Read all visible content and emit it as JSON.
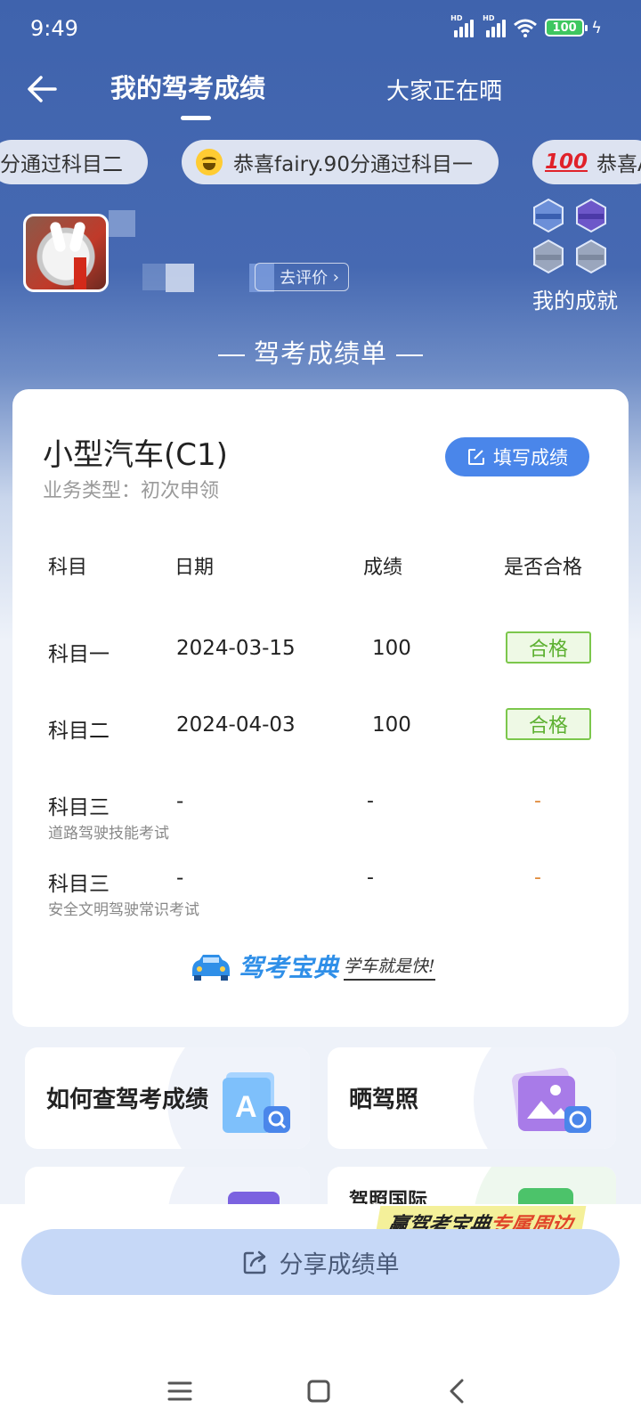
{
  "status_bar": {
    "time": "9:49",
    "signal1_label": "HD",
    "signal2_label": "HD",
    "battery": "100"
  },
  "header": {
    "tabs": [
      {
        "label": "我的驾考成绩",
        "active": true
      },
      {
        "label": "大家正在晒",
        "active": false
      }
    ]
  },
  "ticker": [
    {
      "text": "分通过科目二"
    },
    {
      "text": "恭喜fairy.90分通过科目一",
      "icon": "grinning-face-icon"
    },
    {
      "text": "恭喜A",
      "icon": "hundred-points-icon",
      "icon_text": "100"
    }
  ],
  "profile": {
    "rate_label": "去评价",
    "achievements_label": "我的成就"
  },
  "sheet_title": "驾考成绩单",
  "card": {
    "vehicle": "小型汽车(C1)",
    "business_type": "业务类型：初次申领",
    "fill_button": "填写成绩",
    "columns": [
      "科目",
      "日期",
      "成绩",
      "是否合格"
    ],
    "rows": [
      {
        "subject": "科目一",
        "subtitle": "",
        "date": "2024-03-15",
        "score": "100",
        "result": "合格",
        "passed": true
      },
      {
        "subject": "科目二",
        "subtitle": "",
        "date": "2024-04-03",
        "score": "100",
        "result": "合格",
        "passed": true
      },
      {
        "subject": "科目三",
        "subtitle": "道路驾驶技能考试",
        "date": "-",
        "score": "-",
        "result": "-",
        "passed": false
      },
      {
        "subject": "科目三",
        "subtitle": "安全文明驾驶常识考试",
        "date": "-",
        "score": "-",
        "result": "-",
        "passed": false
      }
    ],
    "brand_name": "驾考宝典",
    "brand_slogan": "学车就是快!"
  },
  "tiles": [
    {
      "label": "如何查驾考成绩",
      "icon": "search-document-icon"
    },
    {
      "label": "晒驾照",
      "icon": "photo-camera-icon"
    },
    {
      "label": "",
      "icon": "purple-card-icon"
    },
    {
      "label": "驾照国际",
      "icon": "green-card-icon"
    }
  ],
  "promo": {
    "part1": "赢驾考宝典",
    "part2": "专属周边"
  },
  "share_button": "分享成绩单",
  "colors": {
    "brand_blue": "#4669b2",
    "accent": "#4a86ea",
    "pass_green": "#5cb030",
    "dash_orange": "#e08a3a"
  }
}
